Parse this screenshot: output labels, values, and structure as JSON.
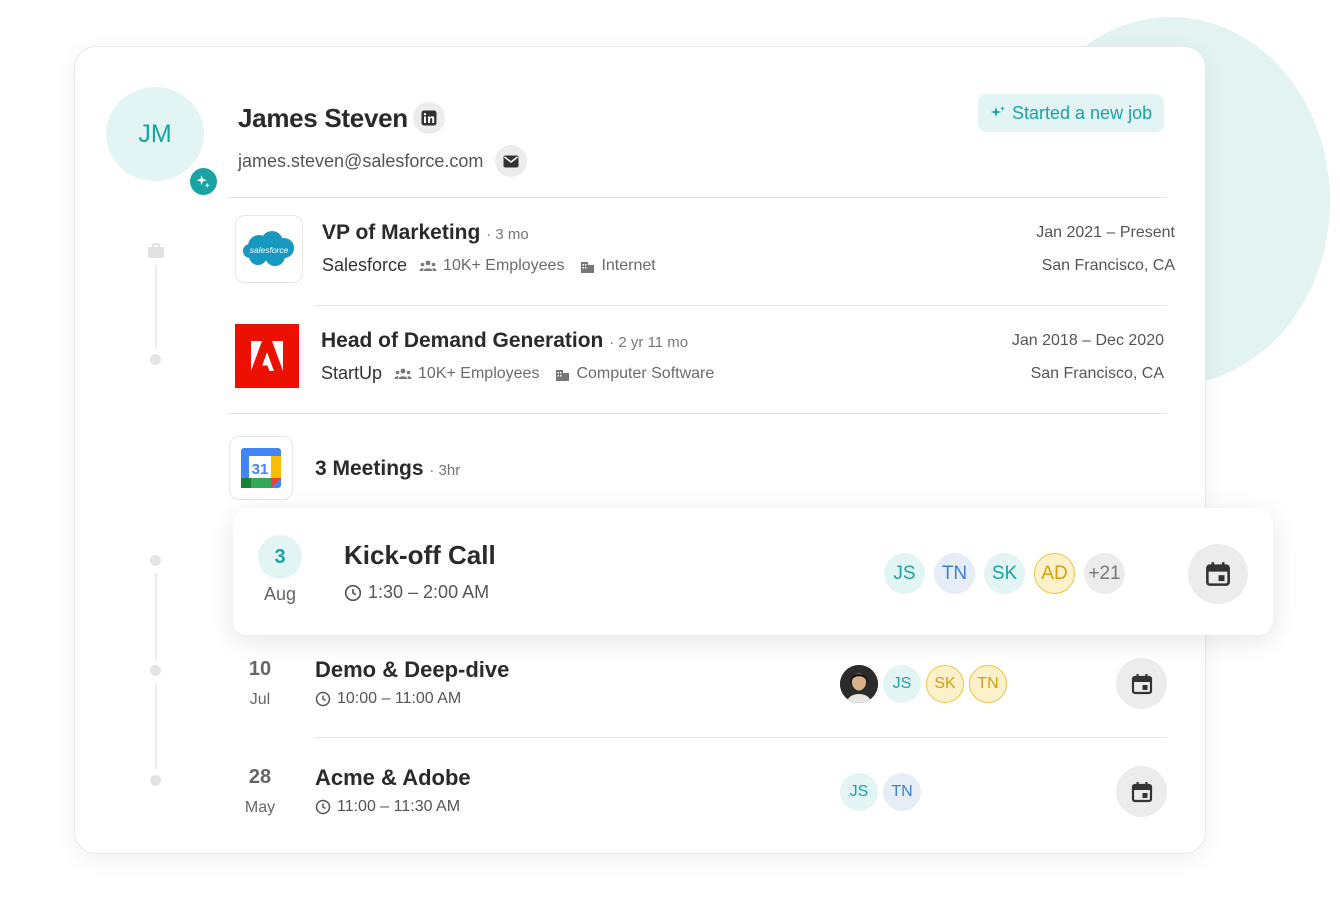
{
  "profile": {
    "initials": "JM",
    "name": "James Steven",
    "email": "james.steven@salesforce.com",
    "status_pill": "Started a new job",
    "linkedin_icon": "linkedin-icon",
    "email_icon": "mail-icon"
  },
  "jobs": [
    {
      "title": "VP of Marketing",
      "duration": "· 3 mo",
      "company": "Salesforce",
      "logo_text": "salesforce",
      "employees": "10K+ Employees",
      "industry": "Internet",
      "dates": "Jan 2021 – Present",
      "location": "San Francisco, CA"
    },
    {
      "title": "Head of Demand Generation",
      "duration": "· 2 yr 11 mo",
      "company": "StartUp",
      "employees": "10K+ Employees",
      "industry": "Computer Software",
      "dates": "Jan 2018 – Dec 2020",
      "location": "San Francisco, CA"
    }
  ],
  "meetings_header": {
    "calendar_day": "31",
    "title": "3 Meetings",
    "duration": "· 3hr"
  },
  "meetings": [
    {
      "day": "3",
      "month": "Aug",
      "title": "Kick-off Call",
      "time": "1:30 – 2:00 AM",
      "attendees": [
        "JS",
        "TN",
        "SK",
        "AD"
      ],
      "more": "+21"
    },
    {
      "day": "10",
      "month": "Jul",
      "title": "Demo & Deep-dive",
      "time": "10:00 – 11:00 AM",
      "attendees": [
        "JS",
        "SK",
        "TN"
      ]
    },
    {
      "day": "28",
      "month": "May",
      "title": "Acme & Adobe",
      "time": "11:00 – 11:30 AM",
      "attendees": [
        "JS",
        "TN"
      ]
    }
  ],
  "colors": {
    "teal": "#1aa3a3",
    "teal_bg": "#e3f4f4",
    "adobe_red": "#eb1000",
    "salesforce_blue": "#1798c1"
  }
}
